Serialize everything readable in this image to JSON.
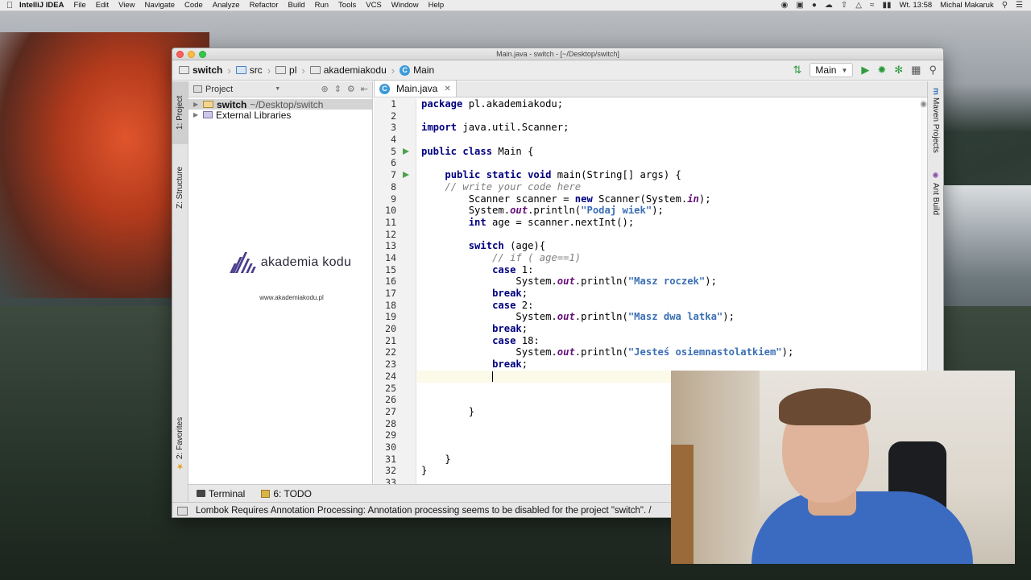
{
  "menubar": {
    "app": "IntelliJ IDEA",
    "menus": [
      "File",
      "Edit",
      "View",
      "Navigate",
      "Code",
      "Analyze",
      "Refactor",
      "Build",
      "Run",
      "Tools",
      "VCS",
      "Window",
      "Help"
    ],
    "clock": "Wt. 13:58",
    "user": "Michal Makaruk"
  },
  "window": {
    "title": "Main.java - switch - [~/Desktop/switch]"
  },
  "breadcrumbs": [
    "switch",
    "src",
    "pl",
    "akademiakodu",
    "Main"
  ],
  "toolbar": {
    "run_config": "Main"
  },
  "left_stripe": {
    "project": "1: Project",
    "structure": "Z: Structure",
    "favorites": "2: Favorites"
  },
  "right_stripe": {
    "maven": "Maven Projects",
    "ant": "Ant Build"
  },
  "project_panel": {
    "header": "Project",
    "root_name": "switch",
    "root_path": "~/Desktop/switch",
    "external": "External Libraries"
  },
  "logo": {
    "name": "akademia kodu",
    "url": "www.akademiakodu.pl"
  },
  "editor": {
    "tab": "Main.java",
    "line_numbers": [
      "1",
      "2",
      "3",
      "4",
      "5",
      "6",
      "7",
      "8",
      "9",
      "10",
      "11",
      "12",
      "13",
      "14",
      "15",
      "16",
      "17",
      "18",
      "19",
      "20",
      "21",
      "22",
      "23",
      "24",
      "25",
      "26",
      "27",
      "28",
      "29",
      "30",
      "31",
      "32",
      "33"
    ],
    "run_marker_lines": [
      5,
      7
    ],
    "current_line": 24,
    "code": {
      "l1_kw": "package",
      "l1_rest": " pl.akademiakodu;",
      "l3_kw": "import",
      "l3_rest": " java.util.Scanner;",
      "l5_kw": "public class",
      "l5_rest": " Main {",
      "l7_kw": "public static void",
      "l7_rest": " main(String[] args) {",
      "l8_cm": "// write your code here",
      "l9_a": "Scanner scanner = ",
      "l9_kw": "new",
      "l9_b": " Scanner(System.",
      "l9_fld": "in",
      "l9_c": ");",
      "l10_a": "System.",
      "l10_fld": "out",
      "l10_b": ".println(",
      "l10_st": "\"Podaj wiek\"",
      "l10_c": ");",
      "l11_kw": "int",
      "l11_rest": " age = scanner.nextInt();",
      "l13_kw": "switch",
      "l13_rest": " (age){",
      "l14_cm": "// if ( age==1)",
      "l15_kw": "case",
      "l15_rest": " 1:",
      "l16_a": "System.",
      "l16_fld": "out",
      "l16_b": ".println(",
      "l16_st": "\"Masz roczek\"",
      "l16_c": ");",
      "l17_kw": "break",
      "l18_kw": "case",
      "l18_rest": " 2:",
      "l19_a": "System.",
      "l19_fld": "out",
      "l19_b": ".println(",
      "l19_st": "\"Masz dwa latka\"",
      "l19_c": ");",
      "l20_kw": "break",
      "l21_kw": "case",
      "l21_rest": " 18:",
      "l22_a": "System.",
      "l22_fld": "out",
      "l22_b": ".println(",
      "l22_st": "\"Jesteś osiemnastolatkiem\"",
      "l22_c": ");",
      "l23_kw": "break",
      "semi": ";",
      "brace": "}"
    }
  },
  "bottom_tabs": {
    "terminal": "Terminal",
    "todo": "6: TODO"
  },
  "status": "Lombok Requires Annotation Processing: Annotation processing seems to be disabled for the project \"switch\". /"
}
